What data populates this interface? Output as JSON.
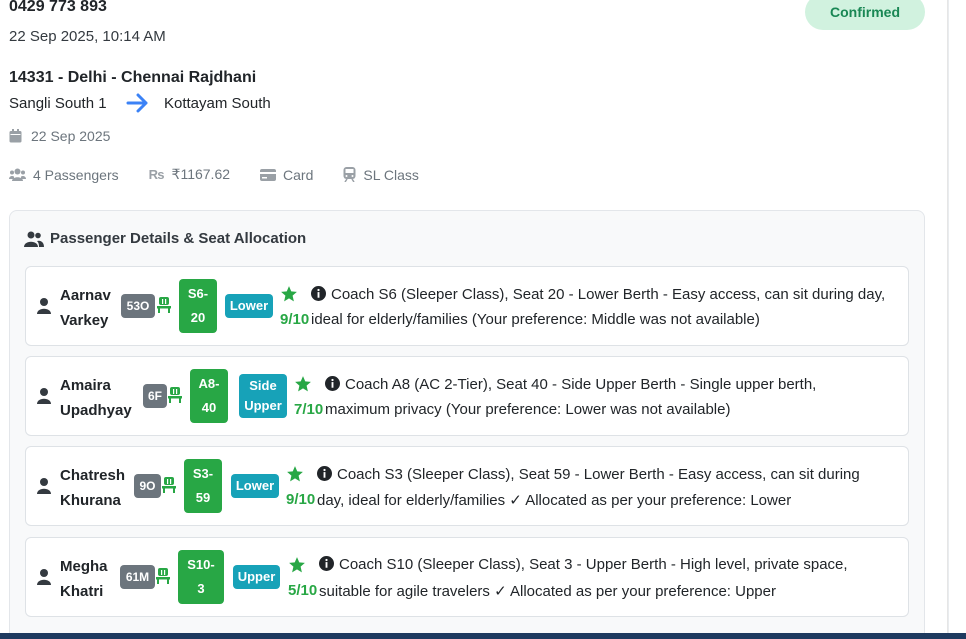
{
  "booking": {
    "phone": "0429 773 893",
    "timestamp": "22 Sep 2025, 10:14 AM",
    "status": "Confirmed",
    "train": "14331 - Delhi - Chennai Rajdhani",
    "from": "Sangli South 1",
    "to": "Kottayam South",
    "date": "22 Sep 2025",
    "passengers_label": "4 Passengers",
    "amount": "₹1167.62",
    "payment": "Card",
    "class": "SL Class"
  },
  "icons": {
    "date": "calendar-icon",
    "passengers": "users-icon",
    "amount": "rupee-icon",
    "payment": "credit-card-icon",
    "class": "train-icon",
    "arrow": "arrow-right-icon"
  },
  "colors": {
    "status_bg": "#d1f2df",
    "status_text": "#198754",
    "seat": "#28a745",
    "berth": "#17a2b8",
    "age": "#6c757d",
    "arrow": "#3b82f6"
  },
  "panel": {
    "title": "Passenger Details & Seat Allocation"
  },
  "passengers": [
    {
      "first": "Aarnav",
      "last": "Varkey",
      "age": "53O",
      "seat_top": "S6-",
      "seat_bottom": "20",
      "berth": "Lower",
      "score": "9/10",
      "desc_line1": "Coach S6 (Sleeper Class), Seat 20 - Lower Berth - Easy access, can sit during day,",
      "desc_line2": "ideal for elderly/families (Your preference: Middle was not available)"
    },
    {
      "first": "Amaira",
      "last": "Upadhyay",
      "age": "6F",
      "seat_top": "A8-",
      "seat_bottom": "40",
      "berth": "Side Upper",
      "score": "7/10",
      "desc_line1": "Coach A8 (AC 2-Tier), Seat 40 - Side Upper Berth - Single upper berth,",
      "desc_line2": "maximum privacy (Your preference: Lower was not available)"
    },
    {
      "first": "Chatresh",
      "last": "Khurana",
      "age": "9O",
      "seat_top": "S3-",
      "seat_bottom": "59",
      "berth": "Lower",
      "score": "9/10",
      "desc_line1": "Coach S3 (Sleeper Class), Seat 59 - Lower Berth - Easy access, can sit during",
      "desc_line2": "day, ideal for elderly/families ✓ Allocated as per your preference: Lower"
    },
    {
      "first": "Megha",
      "last": "Khatri",
      "age": "61M",
      "seat_top": "S10-",
      "seat_bottom": "3",
      "berth": "Upper",
      "score": "5/10",
      "desc_line1": "Coach S10 (Sleeper Class), Seat 3 - Upper Berth - High level, private space,",
      "desc_line2": "suitable for agile travelers ✓ Allocated as per your preference: Upper"
    }
  ]
}
